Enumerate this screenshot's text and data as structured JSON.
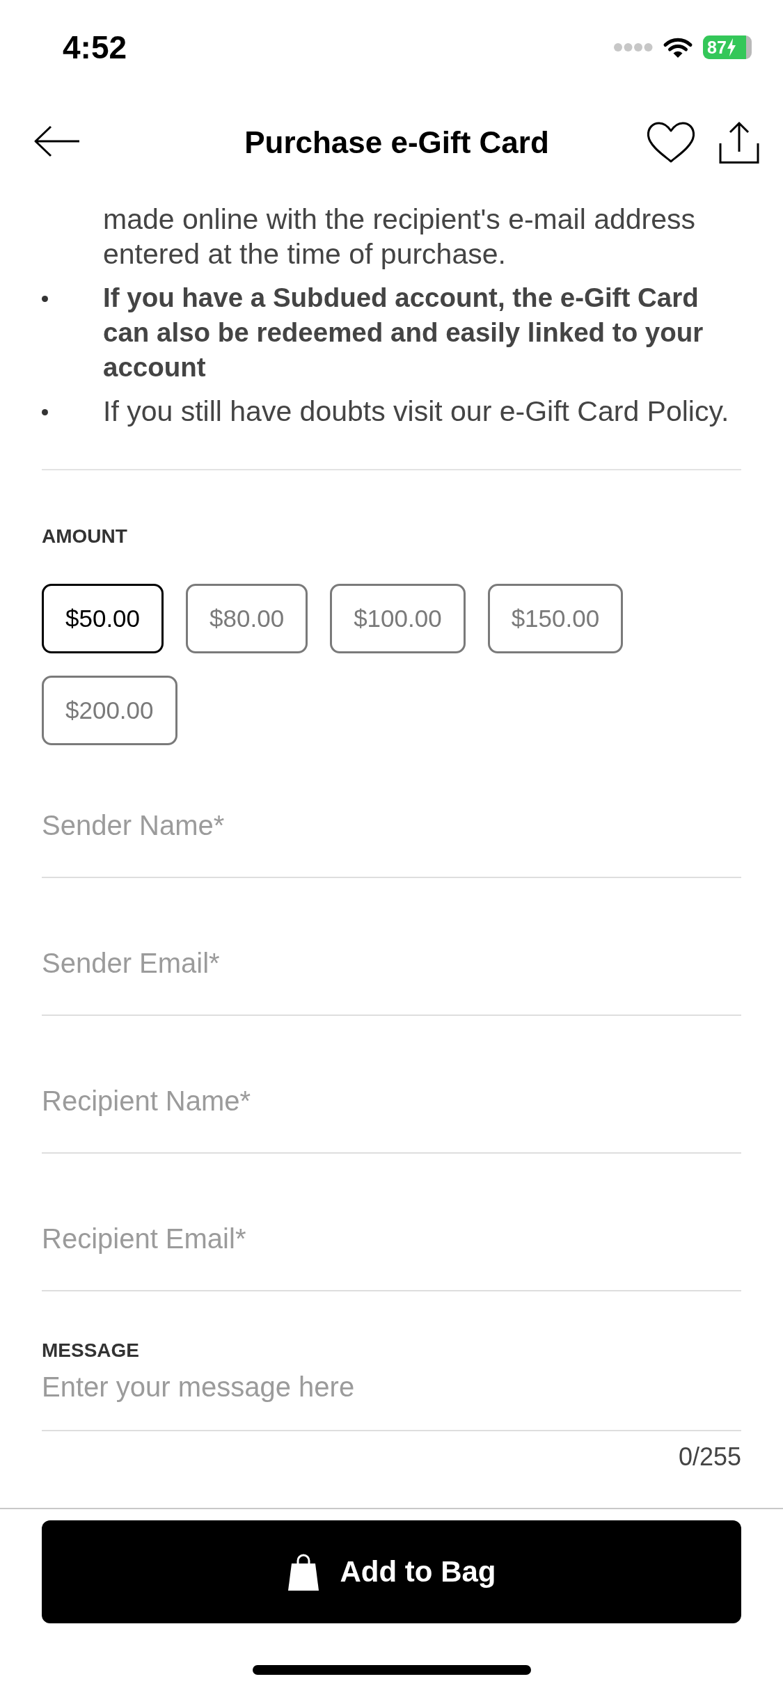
{
  "status_bar": {
    "time": "4:52",
    "battery": "87",
    "charging": true
  },
  "header": {
    "title": "Purchase e-Gift Card"
  },
  "info_list": [
    {
      "kind": "continuation",
      "text": "made online with the recipient's e-mail address entered at the time of purchase.",
      "emphasis": false
    },
    {
      "kind": "bullet",
      "text": "If you have a Subdued account, the e-Gift Card can also be redeemed and easily linked to your account",
      "emphasis": true
    },
    {
      "kind": "bullet",
      "text": "If you still have doubts visit our e-Gift Card Policy.",
      "emphasis": false
    }
  ],
  "amount": {
    "label": "AMOUNT",
    "options": [
      {
        "label": "$50.00",
        "selected": true
      },
      {
        "label": "$80.00",
        "selected": false
      },
      {
        "label": "$100.00",
        "selected": false
      },
      {
        "label": "$150.00",
        "selected": false
      },
      {
        "label": "$200.00",
        "selected": false
      }
    ]
  },
  "fields": [
    {
      "placeholder": "Sender Name*"
    },
    {
      "placeholder": "Sender Email*"
    },
    {
      "placeholder": "Recipient Name*"
    },
    {
      "placeholder": "Recipient Email*"
    }
  ],
  "message": {
    "label": "MESSAGE",
    "placeholder": "Enter your message here",
    "counter": "0/255"
  },
  "add_to_bag": {
    "label": "Add to Bag"
  }
}
